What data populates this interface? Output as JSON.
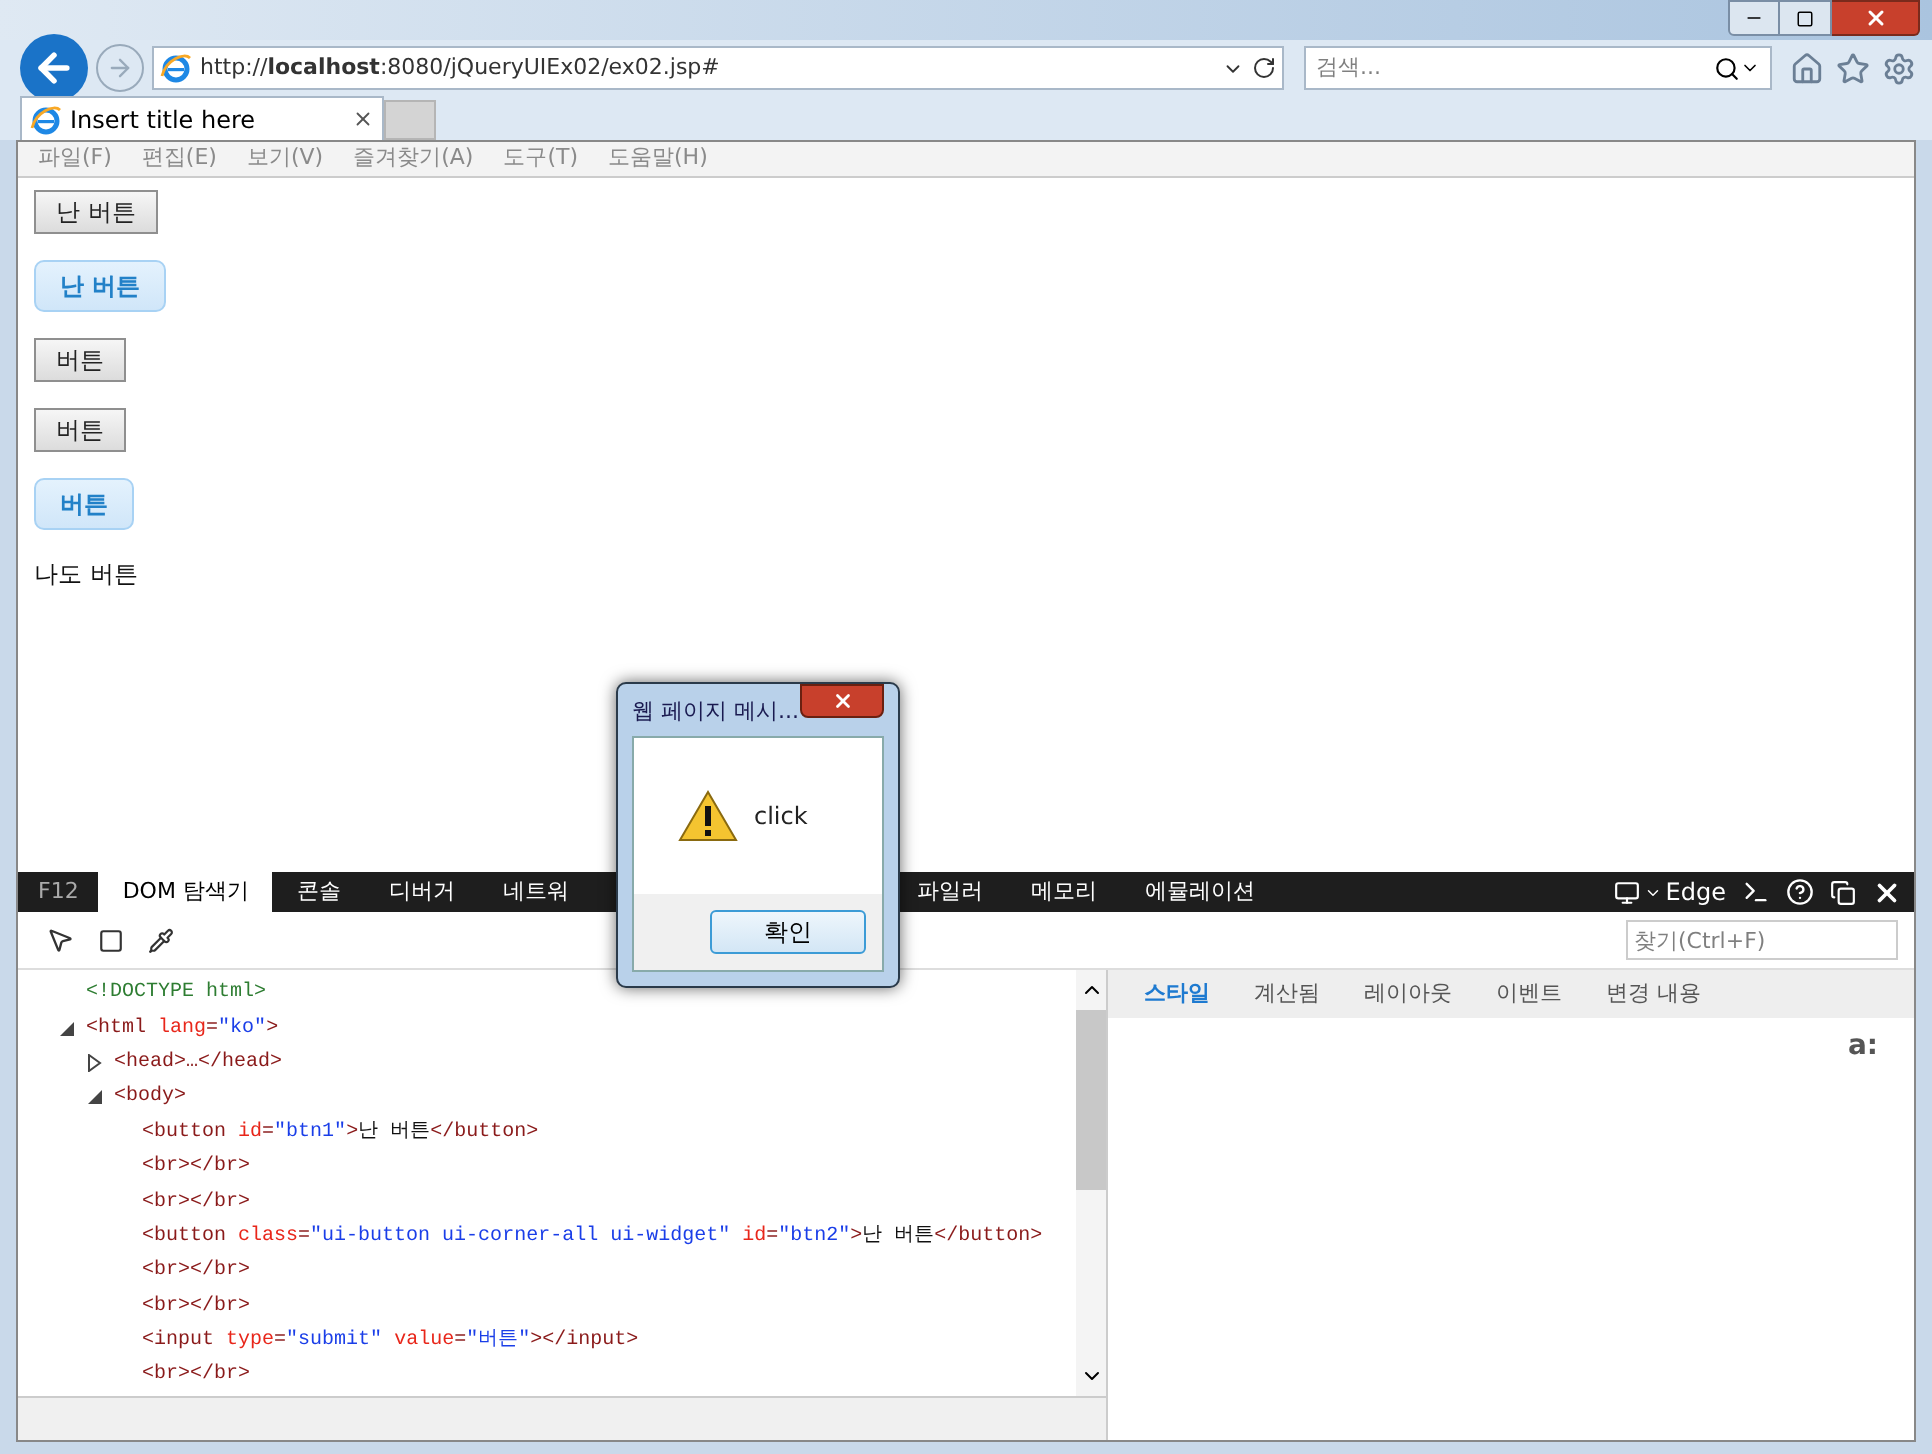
{
  "browser": {
    "address": "http://**localhost**:8080/jQueryUIEx02/ex02.jsp#",
    "search_placeholder": "검색...",
    "tabs": [
      {
        "label": "Insert title here",
        "selected": true
      }
    ],
    "menu": [
      "파일(F)",
      "편집(E)",
      "보기(V)",
      "즐겨찾기(A)",
      "도구(T)",
      "도움말(H)"
    ]
  },
  "page": {
    "items": [
      {
        "kind": "plain-button",
        "label": "난 버튼"
      },
      {
        "kind": "ui-button",
        "label": "난 버튼"
      },
      {
        "kind": "plain-button",
        "label": "버튼"
      },
      {
        "kind": "plain-button",
        "label": "버튼"
      },
      {
        "kind": "ui-button",
        "label": "버튼"
      },
      {
        "kind": "text",
        "label": "나도 버튼"
      }
    ]
  },
  "dialog": {
    "title": "웹 페이지 메시...",
    "message": "click",
    "ok": "확인"
  },
  "devtools": {
    "f12": "F12",
    "tabs": [
      {
        "label": "DOM 탐색기",
        "selected": true
      },
      {
        "label": "콘솔",
        "selected": false
      },
      {
        "label": "디버거",
        "selected": false
      },
      {
        "label": "네트워",
        "selected": false
      },
      {
        "label": "파일러",
        "selected": false
      },
      {
        "label": "메모리",
        "selected": false
      },
      {
        "label": "에뮬레이션",
        "selected": false
      }
    ],
    "mode": "Edge",
    "find_placeholder": "찾기(Ctrl+F)",
    "dom": [
      {
        "tokens": [
          {
            "kind": "doctype",
            "text": "<!DOCTYPE html>"
          }
        ]
      },
      {
        "expanded": true,
        "tokens": [
          {
            "kind": "tag",
            "text": "<html "
          },
          {
            "kind": "attr",
            "text": "lang"
          },
          {
            "kind": "tag",
            "text": "="
          },
          {
            "kind": "value",
            "text": "\"ko\""
          },
          {
            "kind": "tag",
            "text": ">"
          }
        ],
        "children": [
          {
            "expanded": false,
            "tokens": [
              {
                "kind": "tag",
                "text": "<head>…</head>"
              }
            ]
          },
          {
            "expanded": true,
            "tokens": [
              {
                "kind": "tag",
                "text": "<body>"
              }
            ],
            "children": [
              {
                "tokens": [
                  {
                    "kind": "tag",
                    "text": "<button "
                  },
                  {
                    "kind": "attr",
                    "text": "id"
                  },
                  {
                    "kind": "tag",
                    "text": "="
                  },
                  {
                    "kind": "value",
                    "text": "\"btn1\""
                  },
                  {
                    "kind": "tag",
                    "text": ">"
                  },
                  {
                    "kind": "text",
                    "text": "난 버튼"
                  },
                  {
                    "kind": "tag",
                    "text": "</button>"
                  }
                ]
              },
              {
                "tokens": [
                  {
                    "kind": "tag",
                    "text": "<br></br>"
                  }
                ]
              },
              {
                "tokens": [
                  {
                    "kind": "tag",
                    "text": "<br></br>"
                  }
                ]
              },
              {
                "tokens": [
                  {
                    "kind": "tag",
                    "text": "<button "
                  },
                  {
                    "kind": "attr",
                    "text": "class"
                  },
                  {
                    "kind": "tag",
                    "text": "="
                  },
                  {
                    "kind": "value",
                    "text": "\"ui-button ui-corner-all ui-widget\" "
                  },
                  {
                    "kind": "attr",
                    "text": "id"
                  },
                  {
                    "kind": "tag",
                    "text": "="
                  },
                  {
                    "kind": "value",
                    "text": "\"btn2\""
                  },
                  {
                    "kind": "tag",
                    "text": ">"
                  },
                  {
                    "kind": "text",
                    "text": "난 버튼"
                  },
                  {
                    "kind": "tag",
                    "text": "</button>"
                  }
                ]
              },
              {
                "tokens": [
                  {
                    "kind": "tag",
                    "text": "<br></br>"
                  }
                ]
              },
              {
                "tokens": [
                  {
                    "kind": "tag",
                    "text": "<br></br>"
                  }
                ]
              },
              {
                "tokens": [
                  {
                    "kind": "tag",
                    "text": "<input "
                  },
                  {
                    "kind": "attr",
                    "text": "type"
                  },
                  {
                    "kind": "tag",
                    "text": "="
                  },
                  {
                    "kind": "value",
                    "text": "\"submit\" "
                  },
                  {
                    "kind": "attr",
                    "text": "value"
                  },
                  {
                    "kind": "tag",
                    "text": "="
                  },
                  {
                    "kind": "value",
                    "text": "\"버튼\""
                  },
                  {
                    "kind": "tag",
                    "text": "></input>"
                  }
                ]
              },
              {
                "tokens": [
                  {
                    "kind": "tag",
                    "text": "<br></br>"
                  }
                ]
              }
            ]
          }
        ]
      }
    ],
    "side_tabs": [
      {
        "label": "스타일",
        "selected": true
      },
      {
        "label": "계산됨",
        "selected": false
      },
      {
        "label": "레이아웃",
        "selected": false
      },
      {
        "label": "이벤트",
        "selected": false
      },
      {
        "label": "변경 내용",
        "selected": false
      }
    ],
    "style_label": "a:"
  }
}
